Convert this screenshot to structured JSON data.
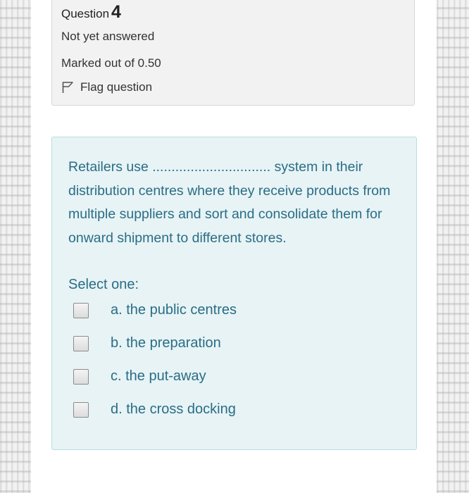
{
  "question_info": {
    "label": "Question",
    "number": "4",
    "status": "Not yet answered",
    "marks": "Marked out of 0.50",
    "flag_label": "Flag question"
  },
  "question": {
    "text": "Retailers use ............................... system in their distribution centres where they receive products from multiple suppliers and sort and consolidate them for onward shipment to different stores.",
    "prompt": "Select one:",
    "options": [
      {
        "label": "a. the public centres",
        "checked": false
      },
      {
        "label": "b. the preparation",
        "checked": false
      },
      {
        "label": "c. the put-away",
        "checked": false
      },
      {
        "label": "d. the cross docking",
        "checked": false
      }
    ]
  }
}
